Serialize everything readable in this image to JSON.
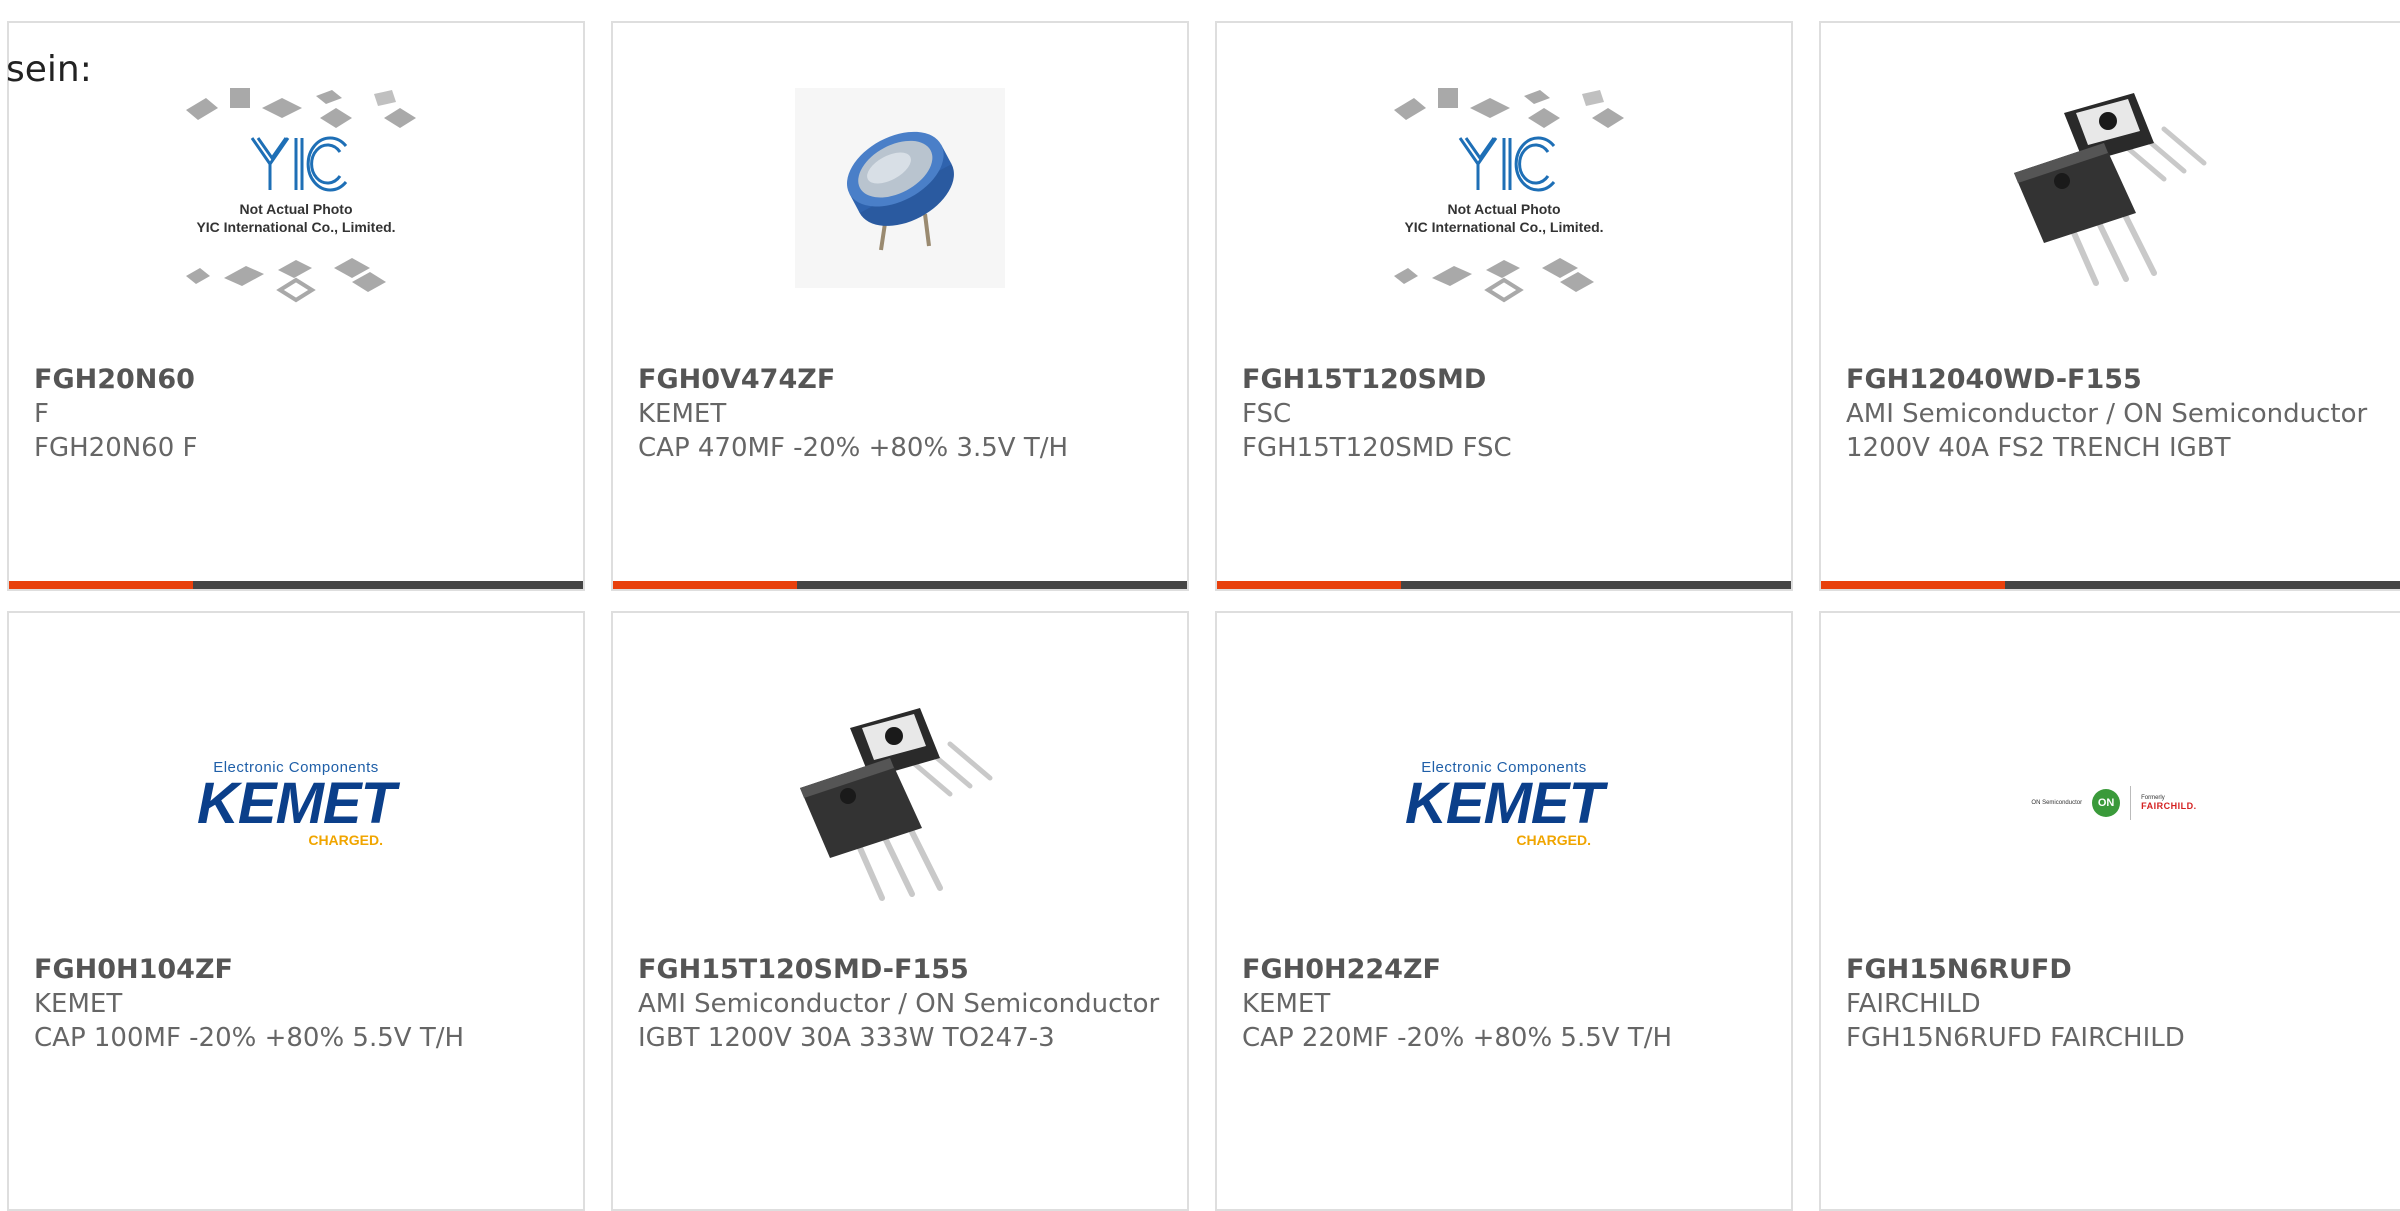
{
  "intro_text": "sein:",
  "colors": {
    "accent_bar": "#e8400c",
    "bar_dark": "#444444",
    "card_border": "#dedede",
    "kemet_blue": "#0b3f8a",
    "kemet_yellow": "#f0a500"
  },
  "yic": {
    "line1": "Not Actual Photo",
    "line2": "YIC International Co., Limited.",
    "logo": "YIC"
  },
  "kemet_logo": {
    "top": "Electronic Components",
    "main": "KEMET",
    "sub": "CHARGED."
  },
  "onsemi_logo": {
    "on": "ON",
    "left": "ON Semiconductor",
    "formerly": "Formerly",
    "fairchild": "FAIRCHILD."
  },
  "products": [
    {
      "part": "FGH20N60",
      "manufacturer": "F",
      "description": "FGH20N60 F",
      "image": "yic-placeholder"
    },
    {
      "part": "FGH0V474ZF",
      "manufacturer": "KEMET",
      "description": "CAP 470MF -20% +80% 3.5V T/H",
      "image": "supercapacitor-photo"
    },
    {
      "part": "FGH15T120SMD",
      "manufacturer": "FSC",
      "description": "FGH15T120SMD FSC",
      "image": "yic-placeholder"
    },
    {
      "part": "FGH12040WD-F155",
      "manufacturer": "AMI Semiconductor / ON Semiconductor",
      "description": "1200V 40A FS2 TRENCH IGBT",
      "image": "to247-transistor-photo"
    },
    {
      "part": "FGH0H104ZF",
      "manufacturer": "KEMET",
      "description": "CAP 100MF -20% +80% 5.5V T/H",
      "image": "kemet-logo"
    },
    {
      "part": "FGH15T120SMD-F155",
      "manufacturer": "AMI Semiconductor / ON Semiconductor",
      "description": "IGBT 1200V 30A 333W TO247-3",
      "image": "to247-transistor-photo"
    },
    {
      "part": "FGH0H224ZF",
      "manufacturer": "KEMET",
      "description": "CAP 220MF -20% +80% 5.5V T/H",
      "image": "kemet-logo"
    },
    {
      "part": "FGH15N6RUFD",
      "manufacturer": "FAIRCHILD",
      "description": "FGH15N6RUFD FAIRCHILD",
      "image": "onsemi-fairchild-logo"
    }
  ]
}
